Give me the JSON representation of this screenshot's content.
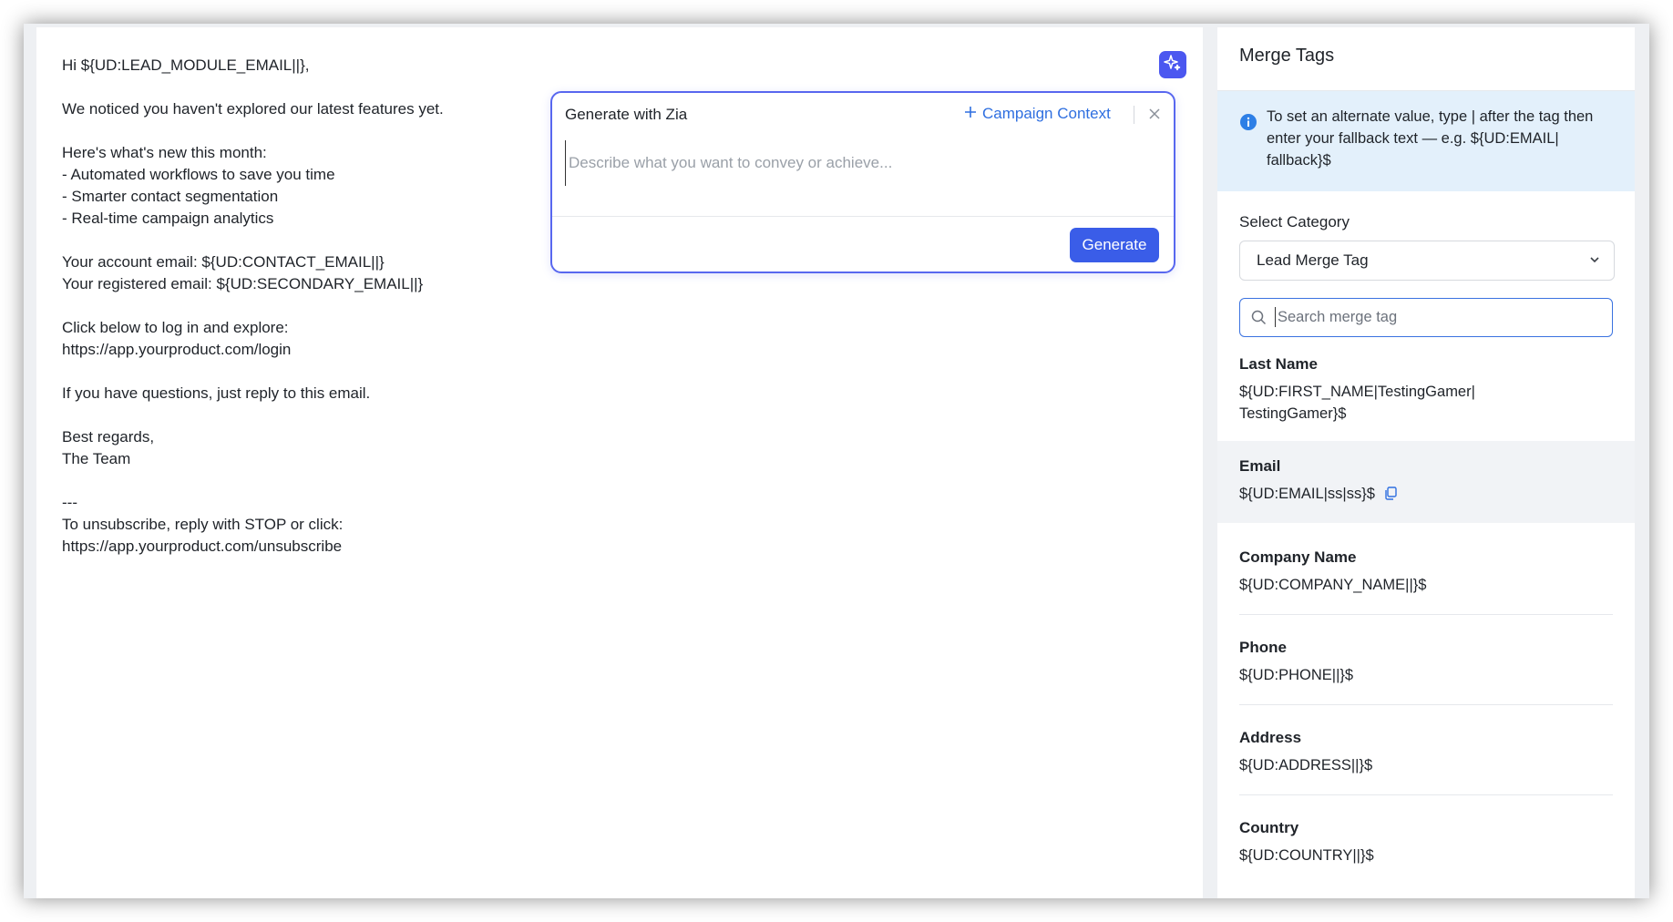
{
  "email": {
    "lines": [
      "Hi ${UD:LEAD_MODULE_EMAIL||},",
      "",
      "We noticed you haven't explored our latest features yet.",
      "",
      "Here's what's new this month:",
      "- Automated workflows to save you time",
      "- Smarter contact segmentation",
      "- Real-time campaign analytics",
      "",
      "Your account email: ${UD:CONTACT_EMAIL||}",
      "Your registered email: ${UD:SECONDARY_EMAIL||}",
      "",
      "Click below to log in and explore:",
      "https://app.yourproduct.com/login",
      "",
      "If you have questions, just reply to this email.",
      "",
      "Best regards,",
      "The Team",
      "",
      "---",
      "To unsubscribe, reply with STOP or click:",
      "https://app.yourproduct.com/unsubscribe"
    ]
  },
  "zia": {
    "title": "Generate with Zia",
    "context_label": "Campaign Context",
    "placeholder": "Describe what you want to convey or achieve...",
    "generate_label": "Generate",
    "accent": "#5867ef"
  },
  "panel": {
    "title": "Merge Tags",
    "info_text": "To set an alternate value, type | after the tag then enter your fallback text — e.g. ${UD:EMAIL| fallback}$",
    "category_label": "Select Category",
    "category_value": "Lead Merge Tag",
    "search_placeholder": "Search merge tag",
    "tags": [
      {
        "name": "Last Name",
        "value": "${UD:FIRST_NAME|TestingGamer|\nTestingGamer}$",
        "highlighted": false
      },
      {
        "name": "Email",
        "value": "${UD:EMAIL|ss|ss}$",
        "highlighted": true
      },
      {
        "name": "Company Name",
        "value": "${UD:COMPANY_NAME||}$",
        "highlighted": false
      },
      {
        "name": "Phone",
        "value": "${UD:PHONE||}$",
        "highlighted": false
      },
      {
        "name": "Address",
        "value": "${UD:ADDRESS||}$",
        "highlighted": false
      },
      {
        "name": "Country",
        "value": "${UD:COUNTRY||}$",
        "highlighted": false
      }
    ]
  },
  "icons": {
    "zia": "sparkle-icon",
    "close": "close-icon",
    "info": "info-icon",
    "chevron": "chevron-down-icon",
    "search": "search-icon",
    "copy": "copy-icon"
  }
}
